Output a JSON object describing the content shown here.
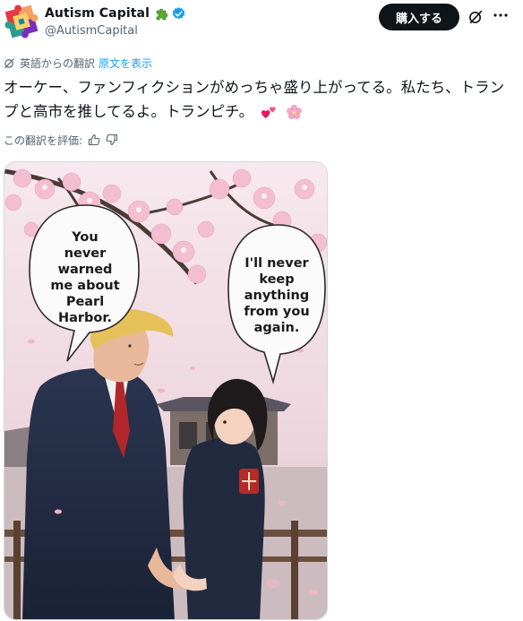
{
  "account": {
    "display_name": "Autism Capital",
    "handle": "@AutismCapital",
    "name_badge": "puzzle-piece-emoji",
    "verified_color": "#1d9bf0"
  },
  "actions": {
    "buy_label": "購入する"
  },
  "translation": {
    "note": "英語からの翻訳",
    "show_original": "原文を表示",
    "rate_label": "この翻訳を評価:"
  },
  "post": {
    "text": "オーケー、ファンフィクションがめっちゃ盛り上がってる。私たち、トランプと高市を推してるよ。トランピチ。",
    "emojis": [
      "two-hearts-emoji",
      "cherry-blossom-emoji"
    ]
  },
  "image": {
    "bubble_left": [
      "You",
      "never",
      "warned",
      "me about",
      "Pearl",
      "Harbor."
    ],
    "bubble_right": [
      "I'll never",
      "keep",
      "anything",
      "from you",
      "again."
    ]
  },
  "colors": {
    "accent": "#1d9bf0",
    "text": "#0f1419",
    "muted": "#536471",
    "button_bg": "#0f1419"
  }
}
